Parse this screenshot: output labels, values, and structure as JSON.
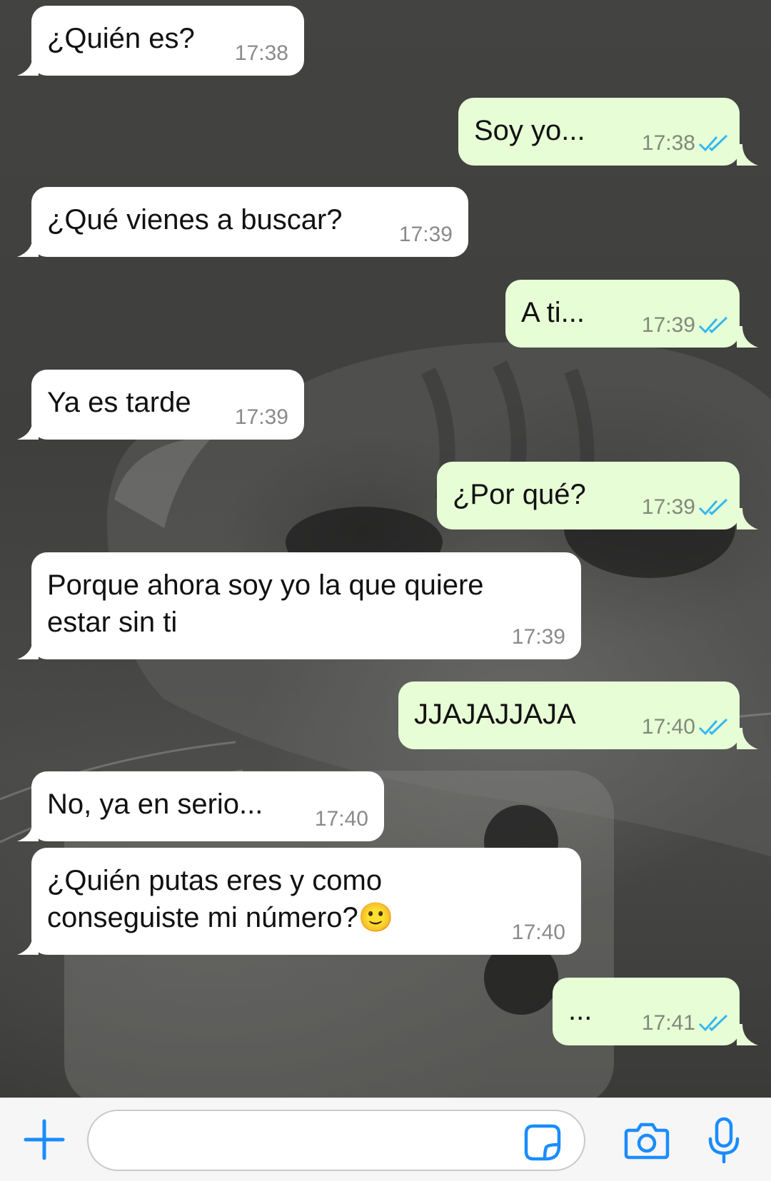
{
  "messages": [
    {
      "side": "in",
      "text": "¿Quién es?",
      "time": "17:38"
    },
    {
      "side": "out",
      "text": "Soy yo...",
      "time": "17:38",
      "status": "read"
    },
    {
      "side": "in",
      "text": "¿Qué vienes a buscar?",
      "time": "17:39"
    },
    {
      "side": "out",
      "text": "A ti...",
      "time": "17:39",
      "status": "read"
    },
    {
      "side": "in",
      "text": "Ya es tarde",
      "time": "17:39"
    },
    {
      "side": "out",
      "text": "¿Por qué?",
      "time": "17:39",
      "status": "read"
    },
    {
      "side": "in",
      "text": "Porque ahora soy yo la que quiere\nestar sin ti",
      "time": "17:39"
    },
    {
      "side": "out",
      "text": "JJAJAJJAJA",
      "time": "17:40",
      "status": "read"
    },
    {
      "side": "in",
      "text": "No, ya en serio...",
      "time": "17:40"
    },
    {
      "side": "in",
      "text": "¿Quién putas eres y como\nconseguiste mi número?🙂",
      "time": "17:40"
    },
    {
      "side": "out",
      "text": "...",
      "time": "17:41",
      "status": "read"
    }
  ],
  "input": {
    "placeholder": "",
    "value": ""
  },
  "icons": {
    "attach": "plus-icon",
    "sticker": "sticker-icon",
    "camera": "camera-icon",
    "mic": "microphone-icon",
    "read_receipt": "double-check-icon"
  },
  "colors": {
    "incoming_bubble": "#ffffff",
    "outgoing_bubble": "#e7fdd5",
    "accent_blue": "#1a8cff",
    "read_tick": "#34b7f1"
  }
}
